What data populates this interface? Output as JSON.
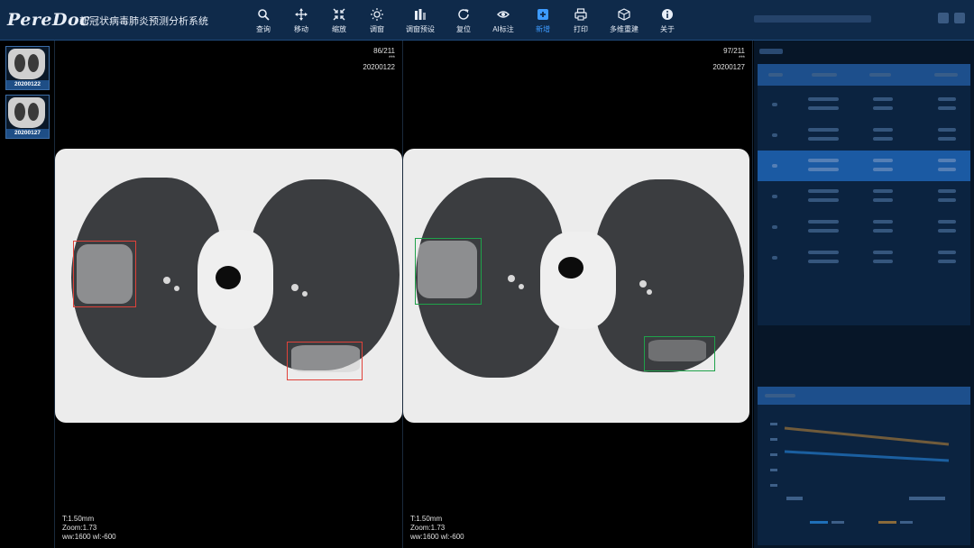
{
  "app": {
    "logo": "PereDoc",
    "title": "新冠状病毒肺炎预测分析系统"
  },
  "toolbar": [
    {
      "label": "查询",
      "icon": "search-icon"
    },
    {
      "label": "移动",
      "icon": "move-icon"
    },
    {
      "label": "缩放",
      "icon": "zoom-icon"
    },
    {
      "label": "调窗",
      "icon": "brightness-icon"
    },
    {
      "label": "调窗预设",
      "icon": "window-preset-icon"
    },
    {
      "label": "复位",
      "icon": "reset-icon"
    },
    {
      "label": "AI标注",
      "icon": "eye-icon"
    },
    {
      "label": "新增",
      "icon": "add-icon",
      "active": true
    },
    {
      "label": "打印",
      "icon": "print-icon"
    },
    {
      "label": "多维重建",
      "icon": "cube-icon"
    },
    {
      "label": "关于",
      "icon": "info-icon"
    }
  ],
  "series": [
    {
      "date": "20200122"
    },
    {
      "date": "20200127"
    }
  ],
  "viewports": [
    {
      "slice": "86/211",
      "marker": "***",
      "date": "20200122",
      "thickness": "T:1.50mm",
      "zoom": "Zoom:1.73",
      "window": "ww:1600 wl:-600"
    },
    {
      "slice": "97/211",
      "marker": "***",
      "date": "20200127",
      "thickness": "T:1.50mm",
      "zoom": "Zoom:1.73",
      "window": "ww:1600 wl:-600"
    }
  ],
  "colors": {
    "header_bg": "#0f2a4a",
    "accent": "#3d9bff",
    "annotation_first": "#e0423a",
    "annotation_second": "#1fa24a",
    "selected_row": "#1b5aa3"
  }
}
